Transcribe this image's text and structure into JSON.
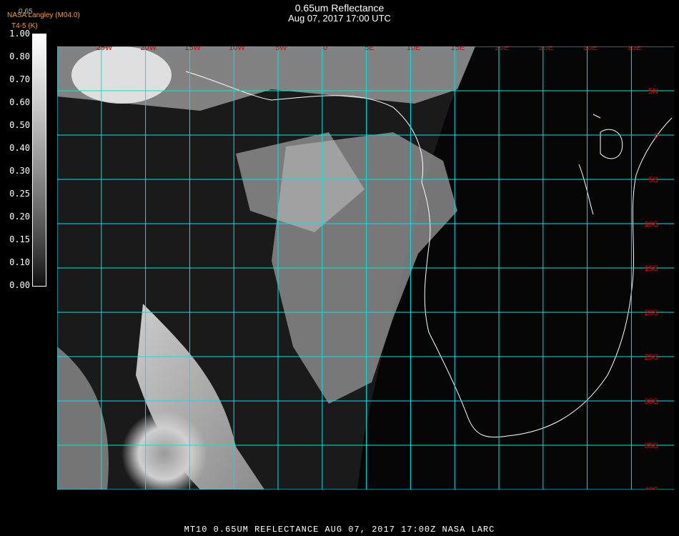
{
  "header": {
    "title": "0.65um Reflectance",
    "datetime": "Aug 07, 2017 17:00 UTC",
    "organization": "NASA Langley (M04.0)",
    "subtitle": "T4-5 (K)",
    "caption": "0.65"
  },
  "colorbar": {
    "ticks": [
      "1.00",
      "0.80",
      "0.70",
      "0.60",
      "0.50",
      "0.40",
      "0.30",
      "0.25",
      "0.20",
      "0.15",
      "0.10",
      "0.00"
    ]
  },
  "map": {
    "grid_color": "#00e5e5",
    "label_color": "#e00000",
    "longitude_labels": [
      "25W",
      "20W",
      "15W",
      "10W",
      "5W",
      "0",
      "5E",
      "10E",
      "15E",
      "20E",
      "25E",
      "30E",
      "35E"
    ],
    "latitude_labels": [
      "5N",
      "0",
      "5S",
      "10S",
      "15S",
      "20S",
      "25S",
      "30S",
      "35S",
      "40S"
    ]
  },
  "footer": {
    "text": "MT10  0.65UM REFLECTANCE   AUG 07, 2017 17:00Z   NASA LARC"
  }
}
